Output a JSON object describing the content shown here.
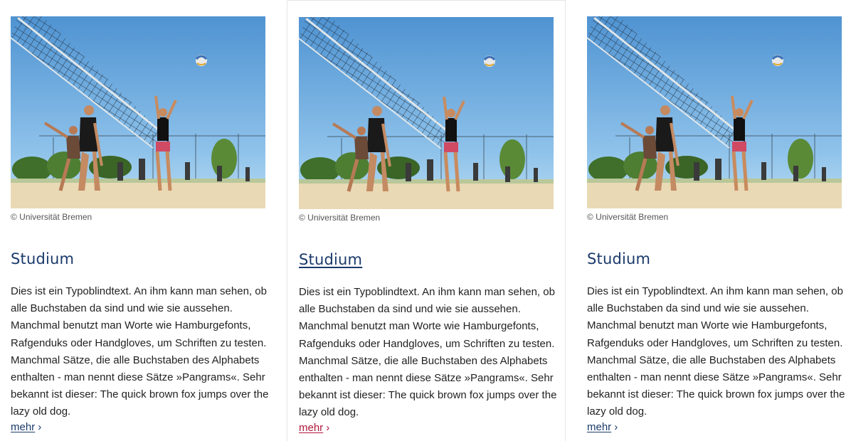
{
  "cards": [
    {
      "image_alt": "Beachvolleyball-Spiel",
      "credit": "© Universität Bremen",
      "title": "Studium",
      "text": "Dies ist ein Typoblindtext. An ihm kann man sehen, ob alle Buchstaben da sind und wie sie aussehen. Manchmal benutzt man Worte wie Hamburgefonts, Rafgenduks oder Handgloves, um Schriften zu testen. Manchmal Sätze, die alle Buchstaben des Alphabets enthalten - man nennt diese Sätze »Pangrams«. Sehr bekannt ist dieser: The quick brown fox jumps over the lazy old dog.",
      "more_label": "mehr",
      "more_icon": "chevron-right-icon"
    },
    {
      "image_alt": "Beachvolleyball-Spiel",
      "credit": "© Universität Bremen",
      "title": "Studium",
      "text": "Dies ist ein Typoblindtext. An ihm kann man sehen, ob alle Buchstaben da sind und wie sie aussehen. Manchmal benutzt man Worte wie Hamburgefonts, Rafgenduks oder Handgloves, um Schriften zu testen. Manchmal Sätze, die alle Buchstaben des Alphabets enthalten - man nennt diese Sätze »Pangrams«. Sehr bekannt ist dieser: The quick brown fox jumps over the lazy old dog.",
      "more_label": "mehr",
      "more_icon": "chevron-right-icon"
    },
    {
      "image_alt": "Beachvolleyball-Spiel",
      "credit": "© Universität Bremen",
      "title": "Studium",
      "text": "Dies ist ein Typoblindtext. An ihm kann man sehen, ob alle Buchstaben da sind und wie sie aussehen. Manchmal benutzt man Worte wie Hamburgefonts, Rafgenduks oder Handgloves, um Schriften zu testen. Manchmal Sätze, die alle Buchstaben des Alphabets enthalten - man nennt diese Sätze »Pangrams«. Sehr bekannt ist dieser: The quick brown fox jumps over the lazy old dog.",
      "more_label": "mehr",
      "more_icon": "chevron-right-icon"
    }
  ],
  "colors": {
    "title": "#1a3a6b",
    "link": "#1a3a6b",
    "link_hover": "#b0173c",
    "text": "#222222",
    "credit": "#555555",
    "card_border": "#e6e6e6"
  }
}
